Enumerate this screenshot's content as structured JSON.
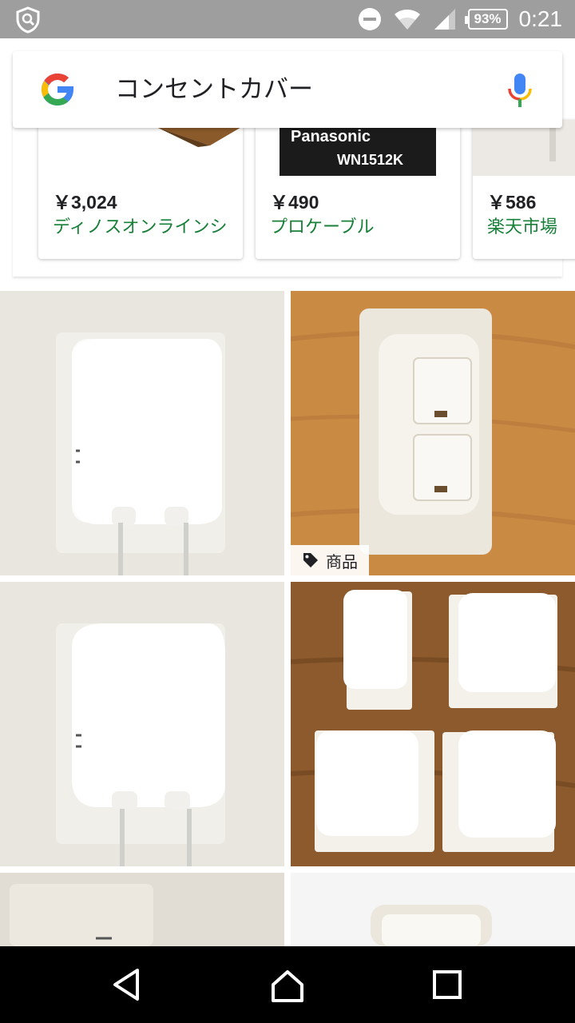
{
  "status_bar": {
    "time": "0:21",
    "battery_percent": "93%",
    "icons": [
      "shield-icon",
      "do-not-disturb-icon",
      "wifi-icon",
      "signal-icon",
      "battery-icon"
    ]
  },
  "search": {
    "query": "コンセントカバー",
    "icons": [
      "google-logo",
      "mic-icon"
    ]
  },
  "shopping": {
    "cards": [
      {
        "price": "￥3,024",
        "merchant": "ディノスオンラインショップ"
      },
      {
        "price": "￥490",
        "merchant": "プロケーブル",
        "image_text_brand": "Panasonic",
        "image_text_model": "WN1512K"
      },
      {
        "price": "￥586",
        "merchant": "楽天市場"
      }
    ]
  },
  "image_results": {
    "product_badge_label": "商品"
  },
  "nav_bar": {
    "icons": [
      "back-icon",
      "home-icon",
      "recents-icon"
    ]
  },
  "colors": {
    "status_bar": "#9e9e9e",
    "merchant_text": "#188038",
    "nav_bar": "#000000"
  }
}
